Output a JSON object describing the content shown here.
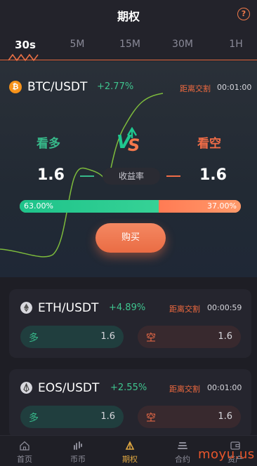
{
  "header": {
    "title": "期权",
    "help_icon": "?"
  },
  "tabs": [
    {
      "label": "30s",
      "active": true
    },
    {
      "label": "5M",
      "active": false
    },
    {
      "label": "15M",
      "active": false
    },
    {
      "label": "30M",
      "active": false
    },
    {
      "label": "1H",
      "active": false
    }
  ],
  "main": {
    "coin_icon": "bitcoin-icon",
    "pair": "BTC/USDT",
    "change": "+2.77%",
    "countdown_label": "距离交割",
    "countdown_time": "00:01:00",
    "bull_label": "看多",
    "bear_label": "看空",
    "bull_rate": "1.6",
    "bear_rate": "1.6",
    "yield_label": "收益率",
    "bull_ratio": 63.0,
    "bear_ratio": 37.0,
    "bull_ratio_text": "63.00%",
    "bear_ratio_text": "37.00%",
    "buy_label": "购买"
  },
  "cards": [
    {
      "icon": "ethereum-icon",
      "pair": "ETH/USDT",
      "change": "+4.89%",
      "countdown_label": "距离交割",
      "countdown_time": "00:00:59",
      "long_label": "多",
      "long_rate": "1.6",
      "short_label": "空",
      "short_rate": "1.6"
    },
    {
      "icon": "eos-icon",
      "pair": "EOS/USDT",
      "change": "+2.55%",
      "countdown_label": "距离交割",
      "countdown_time": "00:01:00",
      "long_label": "多",
      "long_rate": "1.6",
      "short_label": "空",
      "short_rate": "1.6"
    }
  ],
  "nav": [
    {
      "label": "首页",
      "icon": "home-icon",
      "active": false
    },
    {
      "label": "币币",
      "icon": "coin-trade-icon",
      "active": false
    },
    {
      "label": "期权",
      "icon": "options-icon",
      "active": true
    },
    {
      "label": "合约",
      "icon": "contract-icon",
      "active": false
    },
    {
      "label": "资产",
      "icon": "wallet-icon",
      "active": false
    }
  ],
  "watermark": "moyu.us",
  "colors": {
    "bull": "#37b98a",
    "bear": "#ef6c47",
    "accent": "#e86f45",
    "nav_active": "#e0a842"
  }
}
